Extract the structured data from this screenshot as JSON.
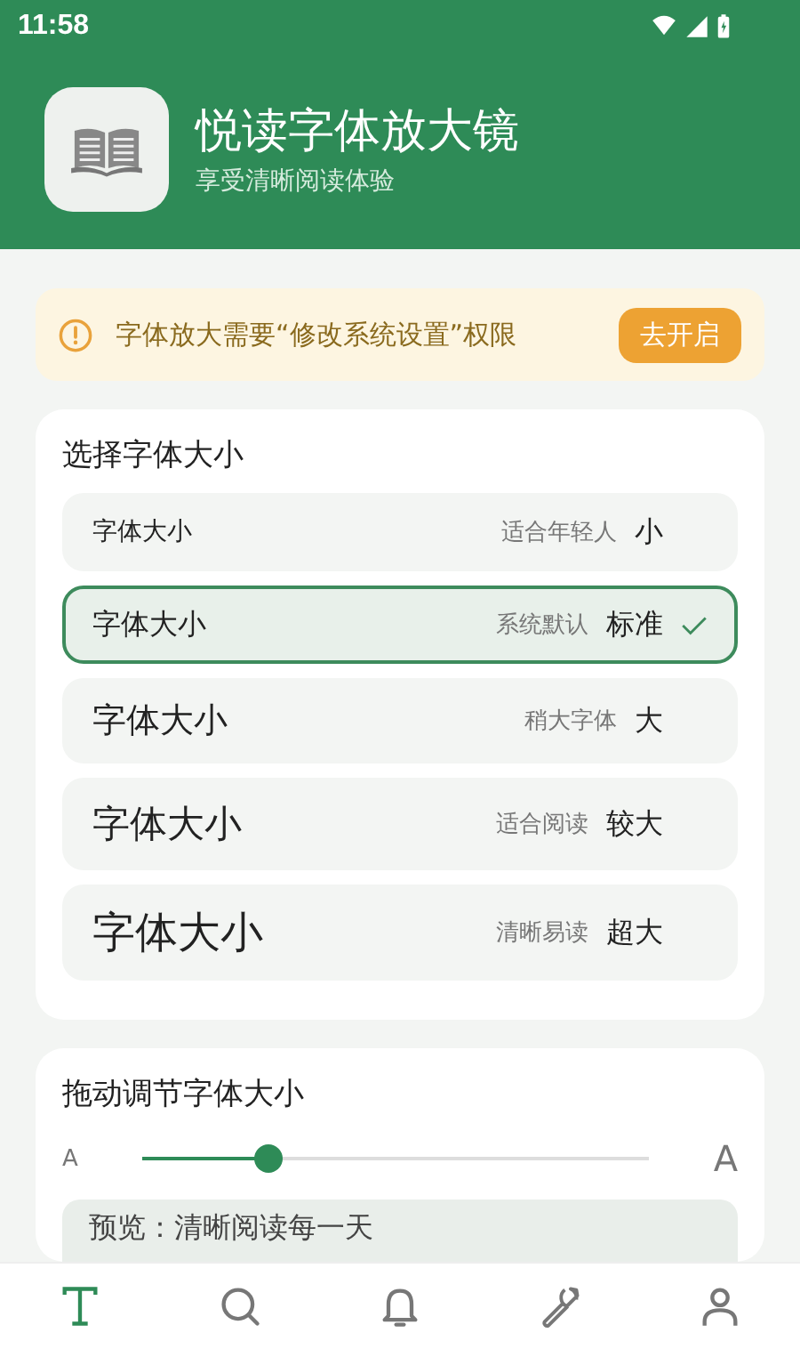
{
  "status_bar": {
    "time": "11:58"
  },
  "header": {
    "title": "悦读字体放大镜",
    "subtitle": "享受清晰阅读体验"
  },
  "notice": {
    "text": "字体放大需要“修改系统设置”权限",
    "button": "去开启"
  },
  "size_card": {
    "title": "选择字体大小",
    "options": [
      {
        "label": "字体大小",
        "hint": "适合年轻人",
        "size": "小",
        "selected": false
      },
      {
        "label": "字体大小",
        "hint": "系统默认",
        "size": "标准",
        "selected": true
      },
      {
        "label": "字体大小",
        "hint": "稍大字体",
        "size": "大",
        "selected": false
      },
      {
        "label": "字体大小",
        "hint": "适合阅读",
        "size": "较大",
        "selected": false
      },
      {
        "label": "字体大小",
        "hint": "清晰易读",
        "size": "超大",
        "selected": false
      }
    ]
  },
  "slider_card": {
    "title": "拖动调节字体大小",
    "min_label": "A",
    "max_label": "A",
    "level": 0.25,
    "preview": "预览：清晰阅读每一天"
  },
  "tabs": [
    {
      "kind": "text",
      "selected": true
    },
    {
      "kind": "search",
      "selected": false
    },
    {
      "kind": "bell",
      "selected": false
    },
    {
      "kind": "wrench",
      "selected": false
    },
    {
      "kind": "person",
      "selected": false
    }
  ]
}
